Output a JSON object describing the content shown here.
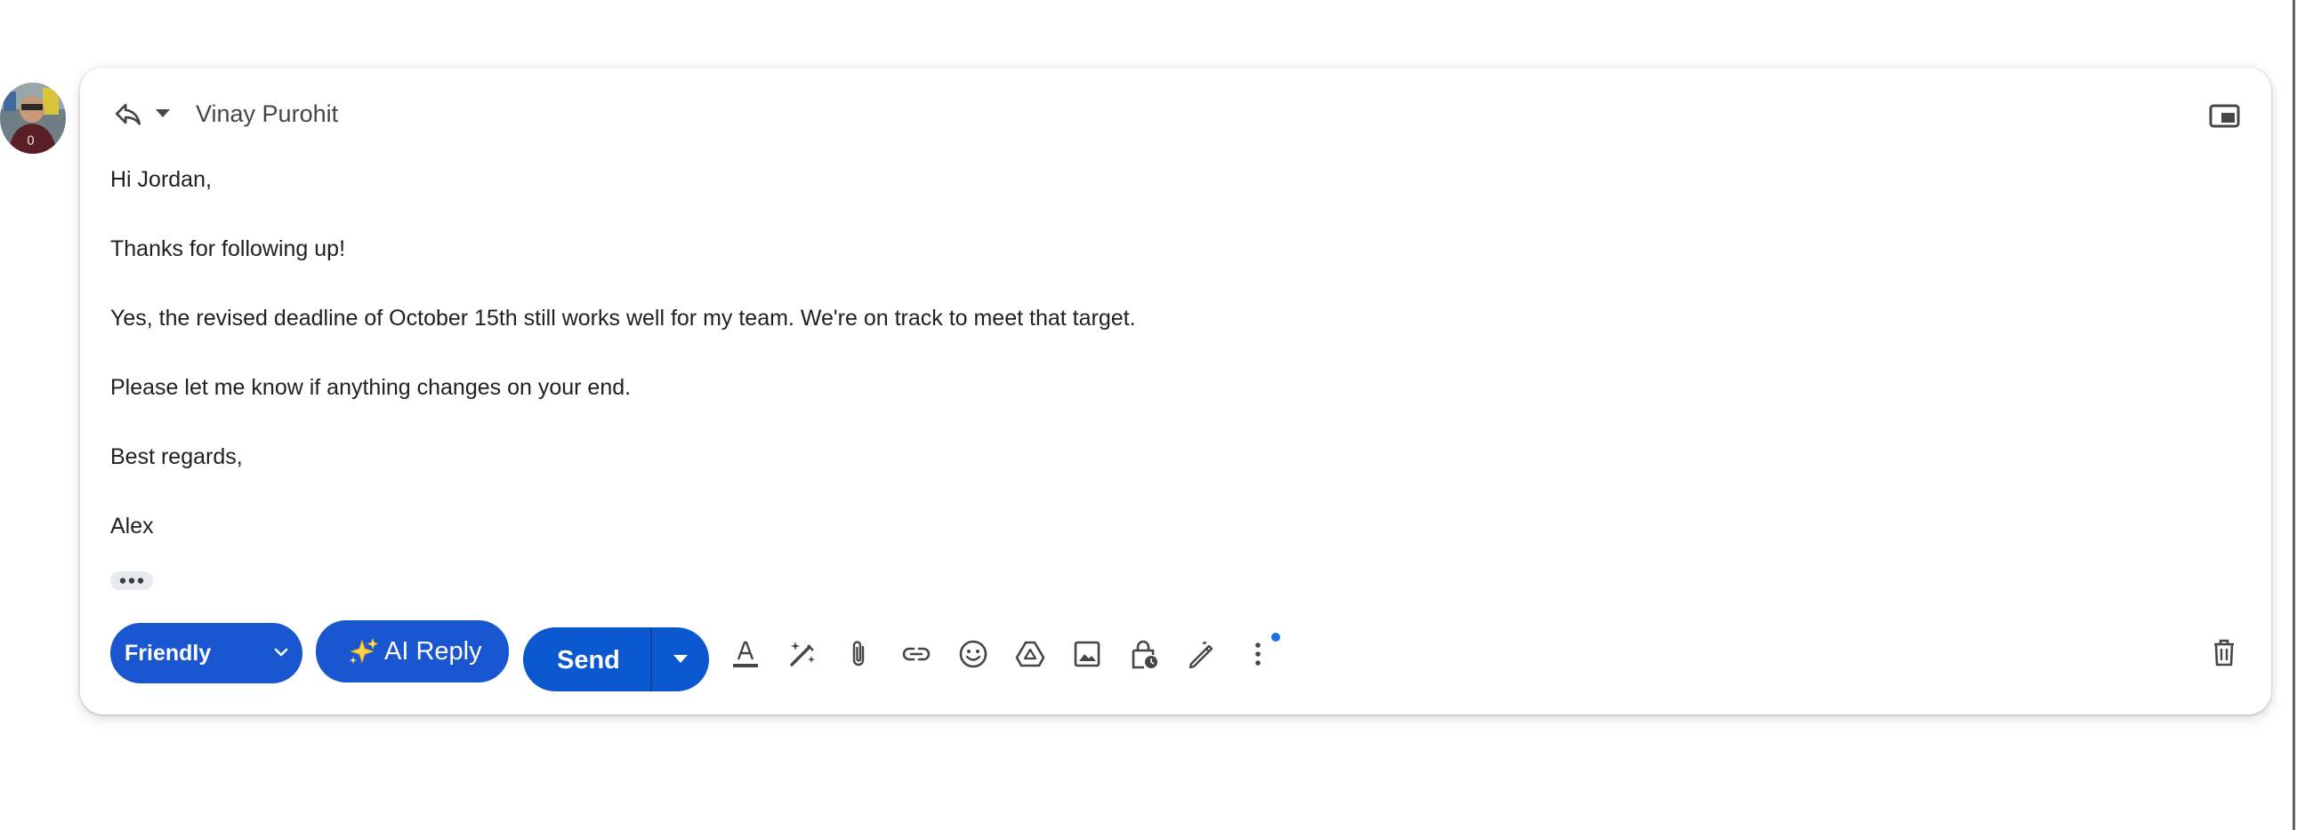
{
  "thread": {
    "recipient_name": "Vinay Purohit"
  },
  "message": {
    "greeting": "Hi Jordan,",
    "line1": "Thanks for following up!",
    "line2": "Yes, the revised deadline of October 15th still works well for my team. We're on track to meet that target.",
    "line3": "Please let me know if anything changes on your end.",
    "closing": "Best regards,",
    "signature": "Alex"
  },
  "toolbar": {
    "tone_value": "Friendly",
    "ai_reply_label": "AI Reply",
    "send_label": "Send"
  },
  "colors": {
    "primary_button": "#0b57d0",
    "tone_button": "#1a56cf",
    "notification_dot": "#1a73e8",
    "icon": "#444746"
  },
  "icons": [
    "reply-icon",
    "reply-options-caret-icon",
    "pop-out-icon",
    "show-trimmed-content-icon",
    "chevron-down-icon",
    "sparkles-icon",
    "send-options-caret-icon",
    "text-formatting-icon",
    "help-me-write-icon",
    "attach-file-icon",
    "insert-link-icon",
    "emoji-icon",
    "google-drive-icon",
    "insert-photo-icon",
    "confidential-mode-icon",
    "signature-icon",
    "more-options-icon",
    "trash-icon"
  ]
}
